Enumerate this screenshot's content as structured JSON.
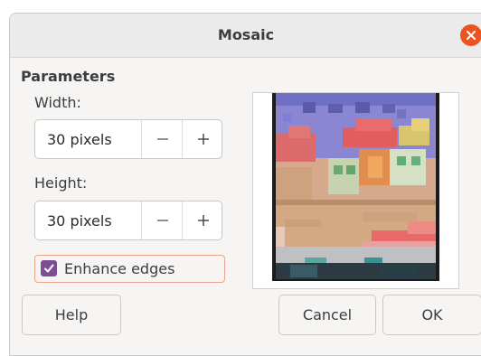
{
  "window": {
    "title": "Mosaic"
  },
  "parameters": {
    "section_title": "Parameters",
    "width": {
      "label": "Width:",
      "value": "30 pixels"
    },
    "height": {
      "label": "Height:",
      "value": "30 pixels"
    },
    "enhance_edges": {
      "label": "Enhance edges",
      "checked": true
    }
  },
  "buttons": {
    "help": "Help",
    "cancel": "Cancel",
    "ok": "OK"
  },
  "colors": {
    "accent_close": "#e9541f",
    "checkbox": "#7d4f90",
    "focus_border": "#e9a48b"
  }
}
